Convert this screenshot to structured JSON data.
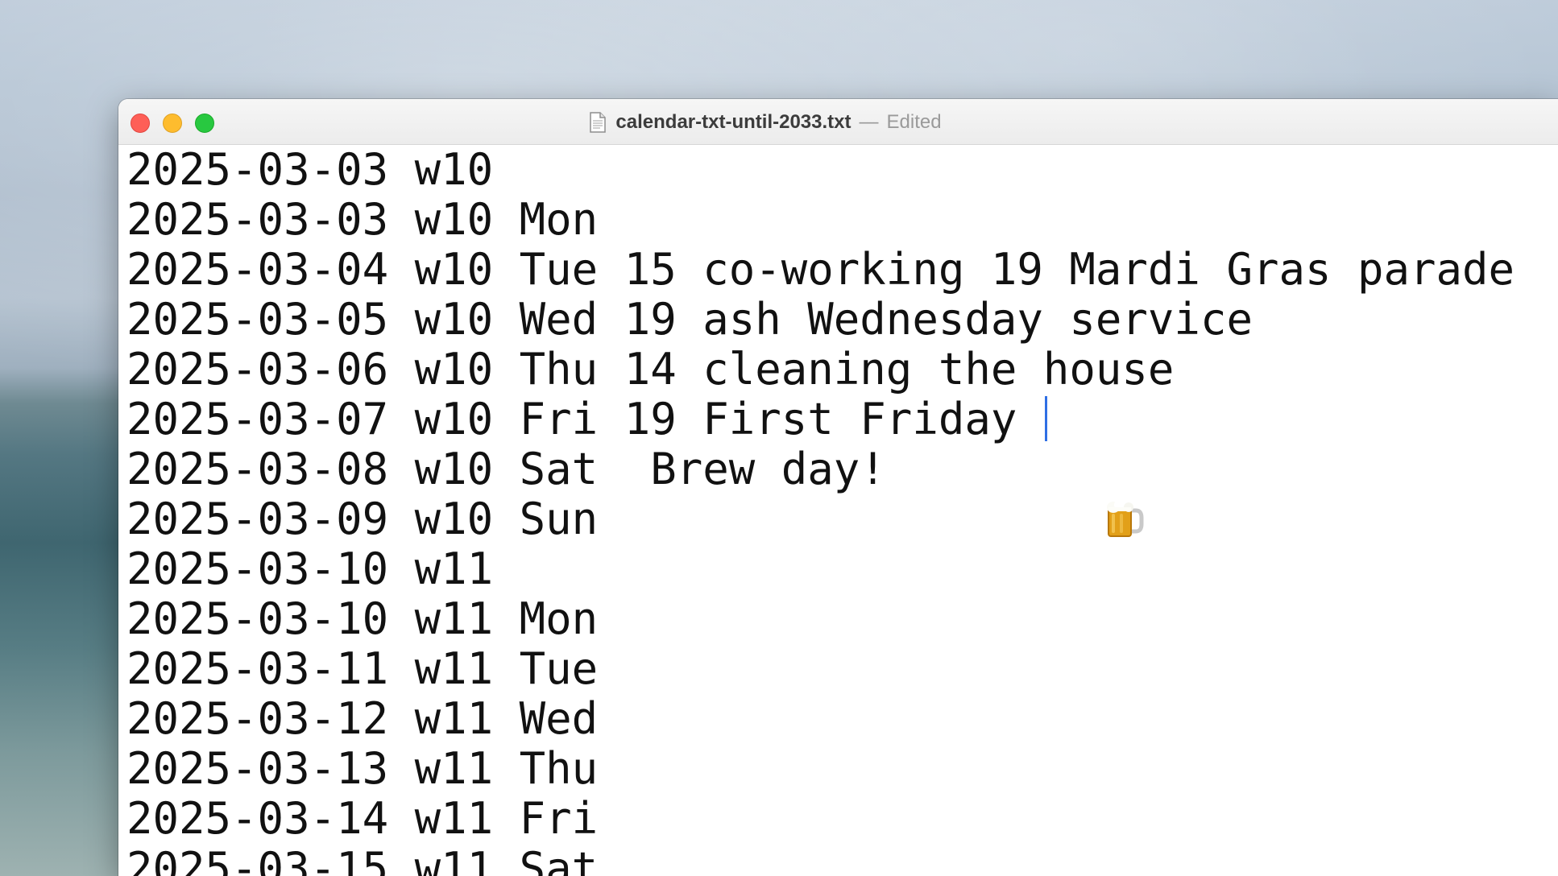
{
  "window": {
    "filename": "calendar-txt-until-2033.txt",
    "separator": "—",
    "status": "Edited"
  },
  "icons": {
    "document": "document-icon",
    "beer": "beer-mug-icon"
  },
  "colors": {
    "close": "#fe5f57",
    "minimize": "#febc2e",
    "zoom": "#28c840",
    "caret": "#2f6fe4"
  },
  "lines": [
    "2025-03-03 w10",
    "2025-03-03 w10 Mon",
    "2025-03-04 w10 Tue 15 co-working 19 Mardi Gras parade",
    "2025-03-05 w10 Wed 19 ash Wednesday service",
    "2025-03-06 w10 Thu 14 cleaning the house",
    "2025-03-07 w10 Fri 19 First Friday ",
    "2025-03-08 w10 Sat  Brew day!",
    "2025-03-09 w10 Sun",
    "2025-03-10 w11",
    "2025-03-10 w11 Mon",
    "2025-03-11 w11 Tue",
    "2025-03-12 w11 Wed",
    "2025-03-13 w11 Thu",
    "2025-03-14 w11 Fri",
    "2025-03-15 w11 Sat"
  ]
}
